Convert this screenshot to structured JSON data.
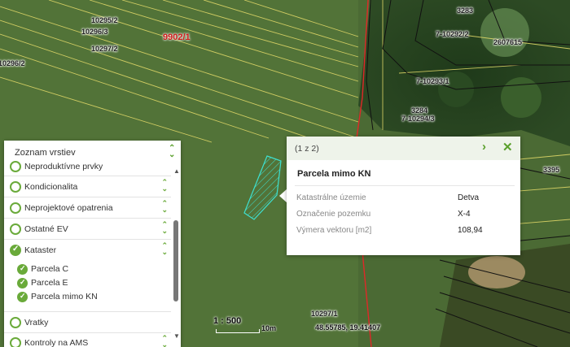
{
  "map": {
    "parcel_labels": [
      "10295/2",
      "10296/3",
      "10297/2",
      "10296/2",
      "10297/1",
      "3283",
      "7-10292/2",
      "2607615",
      "7-10293/1",
      "3284",
      "7-10294/3",
      "3395"
    ],
    "highlight_parcel_label": "9902/1",
    "colors": {
      "parcel_line": "#e6dc6a",
      "boundary_red": "#e02828",
      "highlight": "#3ee0d0"
    }
  },
  "layers_panel": {
    "title": "Zoznam vrstiev",
    "items": [
      {
        "label": "Neproduktívne prvky",
        "checked": false
      },
      {
        "label": "Kondicionalita",
        "checked": false
      },
      {
        "label": "Neprojektové opatrenia",
        "checked": false
      },
      {
        "label": "Ostatné EV",
        "checked": false
      },
      {
        "label": "Kataster",
        "checked": true
      },
      {
        "label": "Vratky",
        "checked": false
      },
      {
        "label": "Kontroly na AMS",
        "checked": false
      }
    ],
    "kataster_sublayers": [
      "Parcela C",
      "Parcela E",
      "Parcela mimo KN"
    ]
  },
  "popup": {
    "count": "(1 z 2)",
    "title": "Parcela mimo KN",
    "rows": [
      {
        "key": "Katastrálne územie",
        "value": "Detva"
      },
      {
        "key": "Označenie pozemku",
        "value": "X-4"
      },
      {
        "key": "Výmera vektoru [m2]",
        "value": "108,94"
      }
    ]
  },
  "scale": {
    "ratio": "1 : 500",
    "bar_label": "10m"
  },
  "coordinates": "48.55785, 19.41407"
}
